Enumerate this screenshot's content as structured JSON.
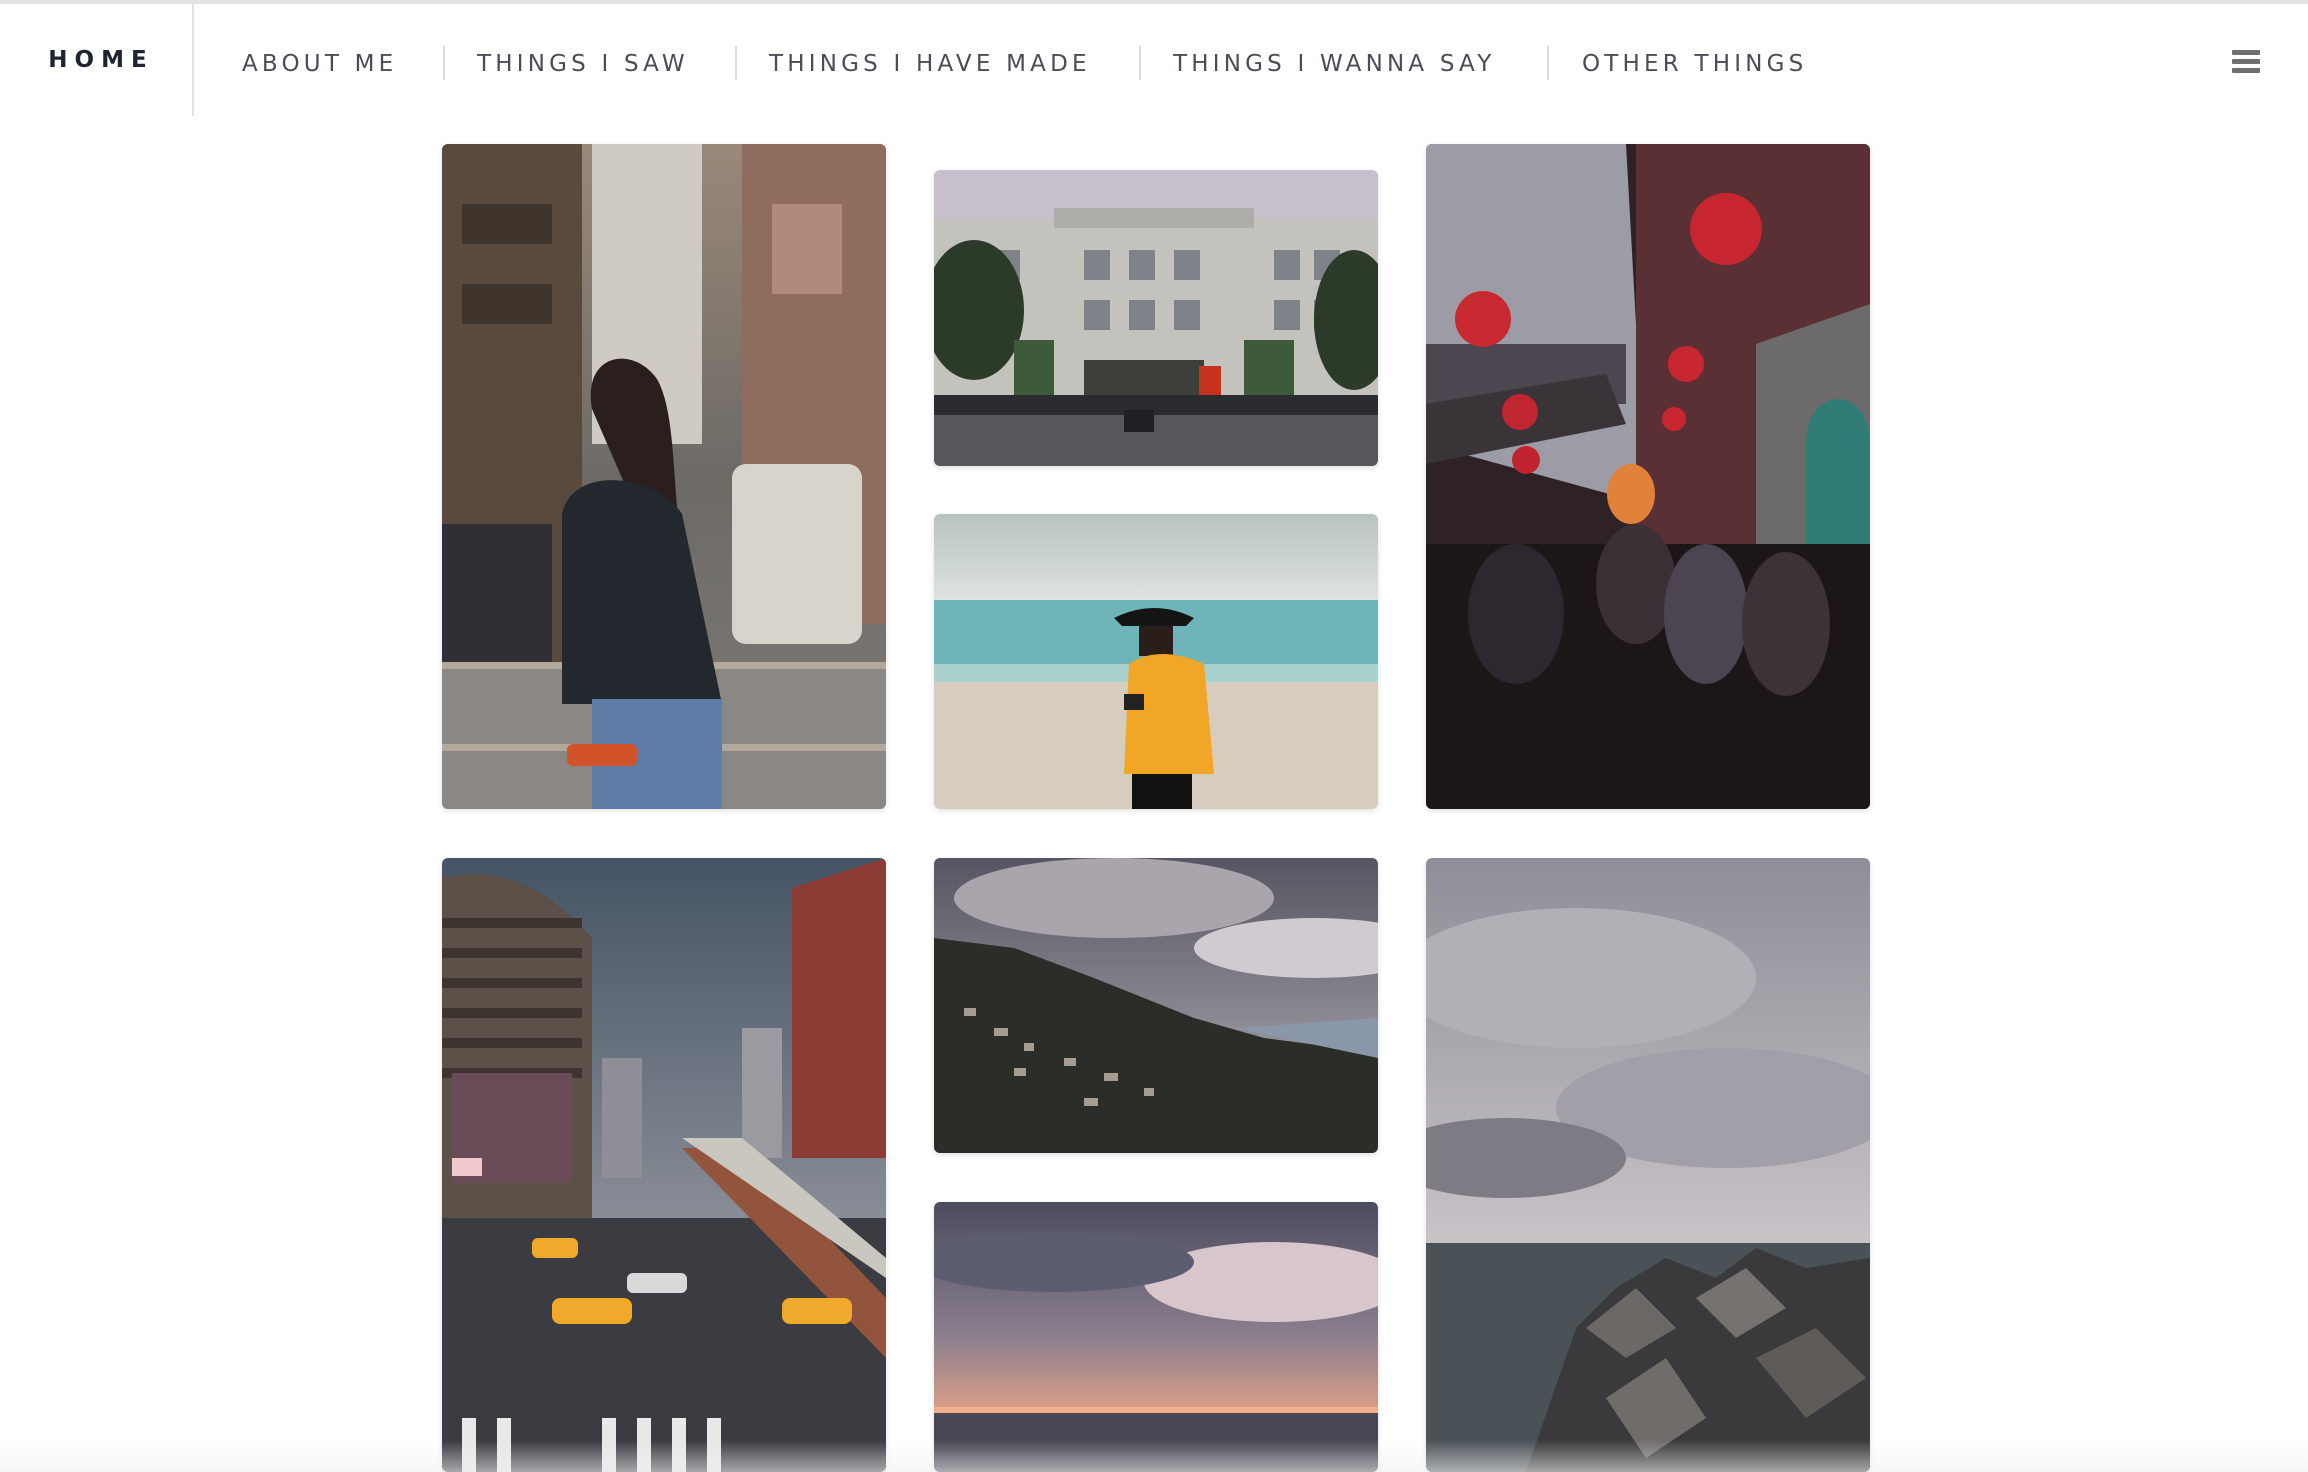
{
  "nav": {
    "brand": "HOME",
    "items": [
      {
        "label": "ABOUT ME"
      },
      {
        "label": "THINGS I SAW"
      },
      {
        "label": "THINGS I HAVE MADE"
      },
      {
        "label": "THINGS I WANNA SAY"
      },
      {
        "label": "OTHER THINGS"
      }
    ],
    "menu_icon": "hamburger-menu-icon"
  },
  "gallery": {
    "photos": [
      {
        "subject": "girl-on-city-street"
      },
      {
        "subject": "government-building"
      },
      {
        "subject": "old-street-red-lanterns"
      },
      {
        "subject": "girl-with-camera-on-beach"
      },
      {
        "subject": "city-intersection-buildings"
      },
      {
        "subject": "hillside-town-cloudy"
      },
      {
        "subject": "sunset-over-sea"
      },
      {
        "subject": "concrete-breakwater-ocean"
      }
    ]
  },
  "colors": {
    "brand_text": "#1f2433",
    "nav_text": "#4a4d55",
    "divider": "#dcdcdc"
  }
}
